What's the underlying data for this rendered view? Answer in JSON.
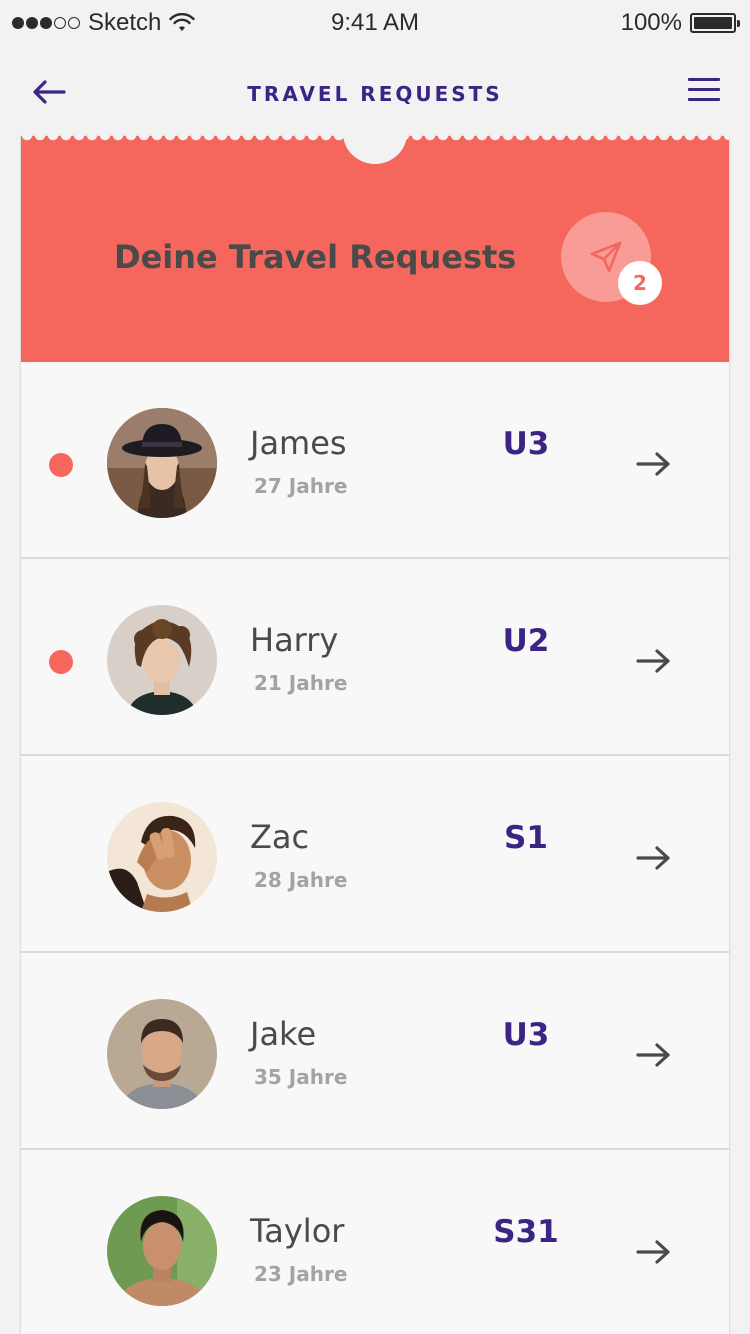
{
  "status_bar": {
    "carrier": "Sketch",
    "time": "9:41 AM",
    "battery": "100%",
    "battery_level": 1.0,
    "signal_bars": 3,
    "signal_total": 5
  },
  "nav": {
    "title": "TRAVEL REQUESTS",
    "back_icon": "arrow-left-icon",
    "menu_icon": "hamburger-menu-icon"
  },
  "header": {
    "title": "Deine Travel Requests",
    "send_icon": "paper-plane-icon",
    "badge_count": "2"
  },
  "colors": {
    "accent": "#f5675d",
    "brand": "#3b2484",
    "text": "#4a4a4a",
    "muted": "#a3a3a3"
  },
  "requests": [
    {
      "name": "James",
      "age": "27 Jahre",
      "line": "U3",
      "unread": true
    },
    {
      "name": "Harry",
      "age": "21 Jahre",
      "line": "U2",
      "unread": true
    },
    {
      "name": "Zac",
      "age": "28 Jahre",
      "line": "S1",
      "unread": false
    },
    {
      "name": "Jake",
      "age": "35 Jahre",
      "line": "U3",
      "unread": false
    },
    {
      "name": "Taylor",
      "age": "23 Jahre",
      "line": "S31",
      "unread": false
    }
  ]
}
